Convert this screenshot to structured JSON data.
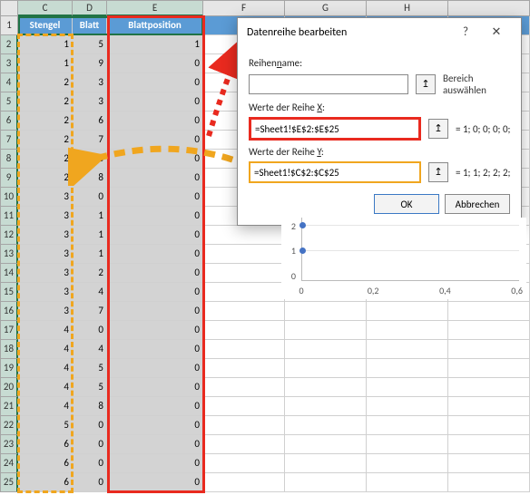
{
  "columns": {
    "C": "C",
    "D": "D",
    "E": "E",
    "F": "F",
    "G": "G",
    "H": "H"
  },
  "widths": {
    "rowhdr": 20,
    "C": 60,
    "D": 38,
    "E": 106,
    "F": 90,
    "G": 90,
    "H": 90,
    "I": 90
  },
  "headers": {
    "C": "Stengel",
    "D": "Blatt",
    "E": "Blattposition"
  },
  "rows": [
    {
      "n": 1
    },
    {
      "n": 2,
      "C": 1,
      "D": 5,
      "E": 1
    },
    {
      "n": 3,
      "C": 1,
      "D": 9,
      "E": 0
    },
    {
      "n": 4,
      "C": 2,
      "D": 3,
      "E": 0
    },
    {
      "n": 5,
      "C": 2,
      "D": 3,
      "E": 0
    },
    {
      "n": 6,
      "C": 2,
      "D": 6,
      "E": 0
    },
    {
      "n": 7,
      "C": 2,
      "D": 7,
      "E": 0
    },
    {
      "n": 8,
      "C": 2,
      "D": 8,
      "E": 0
    },
    {
      "n": 9,
      "C": 2,
      "D": 8,
      "E": 0
    },
    {
      "n": 10,
      "C": 3,
      "D": 0,
      "E": 0
    },
    {
      "n": 11,
      "C": 3,
      "D": 1,
      "E": 0
    },
    {
      "n": 12,
      "C": 3,
      "D": 1,
      "E": 0
    },
    {
      "n": 13,
      "C": 3,
      "D": 1,
      "E": 0
    },
    {
      "n": 14,
      "C": 3,
      "D": 2,
      "E": 0
    },
    {
      "n": 15,
      "C": 3,
      "D": 4,
      "E": 0
    },
    {
      "n": 16,
      "C": 3,
      "D": 7,
      "E": 0
    },
    {
      "n": 17,
      "C": 4,
      "D": 0,
      "E": 0
    },
    {
      "n": 18,
      "C": 4,
      "D": 4,
      "E": 0
    },
    {
      "n": 19,
      "C": 4,
      "D": 5,
      "E": 0
    },
    {
      "n": 20,
      "C": 4,
      "D": 5,
      "E": 0
    },
    {
      "n": 21,
      "C": 4,
      "D": 8,
      "E": 0
    },
    {
      "n": 22,
      "C": 5,
      "D": 0,
      "E": 0
    },
    {
      "n": 23,
      "C": 6,
      "D": 0,
      "E": 0
    },
    {
      "n": 24,
      "C": 6,
      "D": 0,
      "E": 0
    },
    {
      "n": 25,
      "C": 6,
      "D": 0,
      "E": 0
    }
  ],
  "dialog": {
    "title": "Datenreihe bearbeiten",
    "help": "?",
    "close": "✕",
    "name_label": "Reihenname:",
    "name_value": "",
    "name_side": "Bereich auswählen",
    "x_label": "Werte der Reihe X:",
    "x_value": "=Sheet1!$E$2:$E$25",
    "x_preview": "= 1; 0; 0; 0; 0;...",
    "y_label": "Werte der Reihe Y:",
    "y_value": "=Sheet1!$C$2:$C$25",
    "y_preview": "= 1; 1; 2; 2; 2;...",
    "ok": "OK",
    "cancel": "Abbrechen",
    "pick": "↥"
  },
  "chart_data": {
    "type": "scatter",
    "x": [
      0,
      0
    ],
    "y": [
      1,
      2
    ],
    "xlim": [
      0,
      0.6
    ],
    "ylim": [
      0,
      2.5
    ],
    "xticks": [
      0,
      0.2,
      0.4,
      0.6
    ],
    "yticks": [
      0,
      1,
      2
    ],
    "title": "",
    "xlabel": "",
    "ylabel": ""
  }
}
